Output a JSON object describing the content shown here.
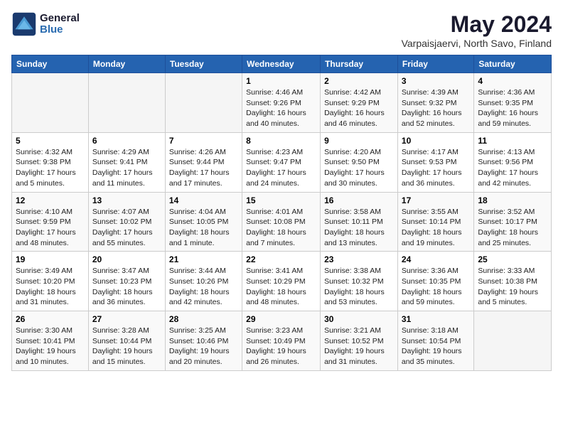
{
  "logo": {
    "line1": "General",
    "line2": "Blue"
  },
  "title": "May 2024",
  "subtitle": "Varpaisjaervi, North Savo, Finland",
  "headers": [
    "Sunday",
    "Monday",
    "Tuesday",
    "Wednesday",
    "Thursday",
    "Friday",
    "Saturday"
  ],
  "weeks": [
    [
      {
        "day": "",
        "sunrise": "",
        "sunset": "",
        "daylight": ""
      },
      {
        "day": "",
        "sunrise": "",
        "sunset": "",
        "daylight": ""
      },
      {
        "day": "",
        "sunrise": "",
        "sunset": "",
        "daylight": ""
      },
      {
        "day": "1",
        "sunrise": "Sunrise: 4:46 AM",
        "sunset": "Sunset: 9:26 PM",
        "daylight": "Daylight: 16 hours and 40 minutes."
      },
      {
        "day": "2",
        "sunrise": "Sunrise: 4:42 AM",
        "sunset": "Sunset: 9:29 PM",
        "daylight": "Daylight: 16 hours and 46 minutes."
      },
      {
        "day": "3",
        "sunrise": "Sunrise: 4:39 AM",
        "sunset": "Sunset: 9:32 PM",
        "daylight": "Daylight: 16 hours and 52 minutes."
      },
      {
        "day": "4",
        "sunrise": "Sunrise: 4:36 AM",
        "sunset": "Sunset: 9:35 PM",
        "daylight": "Daylight: 16 hours and 59 minutes."
      }
    ],
    [
      {
        "day": "5",
        "sunrise": "Sunrise: 4:32 AM",
        "sunset": "Sunset: 9:38 PM",
        "daylight": "Daylight: 17 hours and 5 minutes."
      },
      {
        "day": "6",
        "sunrise": "Sunrise: 4:29 AM",
        "sunset": "Sunset: 9:41 PM",
        "daylight": "Daylight: 17 hours and 11 minutes."
      },
      {
        "day": "7",
        "sunrise": "Sunrise: 4:26 AM",
        "sunset": "Sunset: 9:44 PM",
        "daylight": "Daylight: 17 hours and 17 minutes."
      },
      {
        "day": "8",
        "sunrise": "Sunrise: 4:23 AM",
        "sunset": "Sunset: 9:47 PM",
        "daylight": "Daylight: 17 hours and 24 minutes."
      },
      {
        "day": "9",
        "sunrise": "Sunrise: 4:20 AM",
        "sunset": "Sunset: 9:50 PM",
        "daylight": "Daylight: 17 hours and 30 minutes."
      },
      {
        "day": "10",
        "sunrise": "Sunrise: 4:17 AM",
        "sunset": "Sunset: 9:53 PM",
        "daylight": "Daylight: 17 hours and 36 minutes."
      },
      {
        "day": "11",
        "sunrise": "Sunrise: 4:13 AM",
        "sunset": "Sunset: 9:56 PM",
        "daylight": "Daylight: 17 hours and 42 minutes."
      }
    ],
    [
      {
        "day": "12",
        "sunrise": "Sunrise: 4:10 AM",
        "sunset": "Sunset: 9:59 PM",
        "daylight": "Daylight: 17 hours and 48 minutes."
      },
      {
        "day": "13",
        "sunrise": "Sunrise: 4:07 AM",
        "sunset": "Sunset: 10:02 PM",
        "daylight": "Daylight: 17 hours and 55 minutes."
      },
      {
        "day": "14",
        "sunrise": "Sunrise: 4:04 AM",
        "sunset": "Sunset: 10:05 PM",
        "daylight": "Daylight: 18 hours and 1 minute."
      },
      {
        "day": "15",
        "sunrise": "Sunrise: 4:01 AM",
        "sunset": "Sunset: 10:08 PM",
        "daylight": "Daylight: 18 hours and 7 minutes."
      },
      {
        "day": "16",
        "sunrise": "Sunrise: 3:58 AM",
        "sunset": "Sunset: 10:11 PM",
        "daylight": "Daylight: 18 hours and 13 minutes."
      },
      {
        "day": "17",
        "sunrise": "Sunrise: 3:55 AM",
        "sunset": "Sunset: 10:14 PM",
        "daylight": "Daylight: 18 hours and 19 minutes."
      },
      {
        "day": "18",
        "sunrise": "Sunrise: 3:52 AM",
        "sunset": "Sunset: 10:17 PM",
        "daylight": "Daylight: 18 hours and 25 minutes."
      }
    ],
    [
      {
        "day": "19",
        "sunrise": "Sunrise: 3:49 AM",
        "sunset": "Sunset: 10:20 PM",
        "daylight": "Daylight: 18 hours and 31 minutes."
      },
      {
        "day": "20",
        "sunrise": "Sunrise: 3:47 AM",
        "sunset": "Sunset: 10:23 PM",
        "daylight": "Daylight: 18 hours and 36 minutes."
      },
      {
        "day": "21",
        "sunrise": "Sunrise: 3:44 AM",
        "sunset": "Sunset: 10:26 PM",
        "daylight": "Daylight: 18 hours and 42 minutes."
      },
      {
        "day": "22",
        "sunrise": "Sunrise: 3:41 AM",
        "sunset": "Sunset: 10:29 PM",
        "daylight": "Daylight: 18 hours and 48 minutes."
      },
      {
        "day": "23",
        "sunrise": "Sunrise: 3:38 AM",
        "sunset": "Sunset: 10:32 PM",
        "daylight": "Daylight: 18 hours and 53 minutes."
      },
      {
        "day": "24",
        "sunrise": "Sunrise: 3:36 AM",
        "sunset": "Sunset: 10:35 PM",
        "daylight": "Daylight: 18 hours and 59 minutes."
      },
      {
        "day": "25",
        "sunrise": "Sunrise: 3:33 AM",
        "sunset": "Sunset: 10:38 PM",
        "daylight": "Daylight: 19 hours and 5 minutes."
      }
    ],
    [
      {
        "day": "26",
        "sunrise": "Sunrise: 3:30 AM",
        "sunset": "Sunset: 10:41 PM",
        "daylight": "Daylight: 19 hours and 10 minutes."
      },
      {
        "day": "27",
        "sunrise": "Sunrise: 3:28 AM",
        "sunset": "Sunset: 10:44 PM",
        "daylight": "Daylight: 19 hours and 15 minutes."
      },
      {
        "day": "28",
        "sunrise": "Sunrise: 3:25 AM",
        "sunset": "Sunset: 10:46 PM",
        "daylight": "Daylight: 19 hours and 20 minutes."
      },
      {
        "day": "29",
        "sunrise": "Sunrise: 3:23 AM",
        "sunset": "Sunset: 10:49 PM",
        "daylight": "Daylight: 19 hours and 26 minutes."
      },
      {
        "day": "30",
        "sunrise": "Sunrise: 3:21 AM",
        "sunset": "Sunset: 10:52 PM",
        "daylight": "Daylight: 19 hours and 31 minutes."
      },
      {
        "day": "31",
        "sunrise": "Sunrise: 3:18 AM",
        "sunset": "Sunset: 10:54 PM",
        "daylight": "Daylight: 19 hours and 35 minutes."
      },
      {
        "day": "",
        "sunrise": "",
        "sunset": "",
        "daylight": ""
      }
    ]
  ]
}
